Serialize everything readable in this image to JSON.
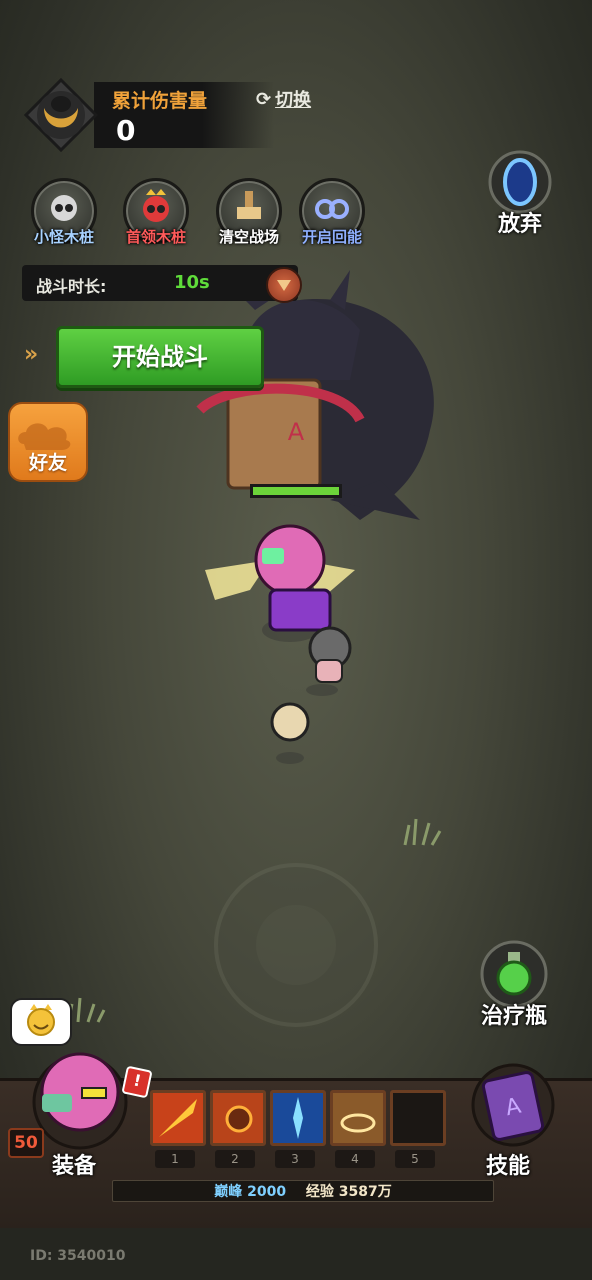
{
  "damage": {
    "label": "累计伤害量",
    "value": "0",
    "switch_label": "切换"
  },
  "quick_buttons": [
    {
      "label": "小怪木桩",
      "color": "#a8d2ff"
    },
    {
      "label": "首领木桩",
      "color": "#ff5a5a"
    },
    {
      "label": "清空战场",
      "color": "#ffffff"
    },
    {
      "label": "开启回能",
      "color": "#8fb0ff"
    }
  ],
  "duration": {
    "label": "战斗时长:",
    "value": "10s"
  },
  "start_button": "开始战斗",
  "friends_label": "好友",
  "give_up_label": "放弃",
  "potion_label": "治疗瓶",
  "bottom": {
    "equip_label": "装备",
    "skill_label": "技能",
    "level": "50",
    "alert": "!",
    "slots": [
      "1",
      "2",
      "3",
      "4",
      "5"
    ],
    "peak_label": "巅峰 2000",
    "exp_label": "经验 3587万"
  },
  "user_id": "ID: 3540010",
  "colors": {
    "accent_orange": "#f0a23a",
    "start_green": "#3fb02e",
    "duration_green": "#5fdc3a",
    "exp_peak": "#7fd0ff"
  },
  "icons": [
    "horned-helmet-icon",
    "refresh-icon",
    "skull-icon",
    "red-skull-icon",
    "broom-icon",
    "infinity-icon",
    "portal-icon",
    "green-potion-icon",
    "purple-spellbook-icon",
    "cloud-icon",
    "cat-emoji-icon"
  ]
}
